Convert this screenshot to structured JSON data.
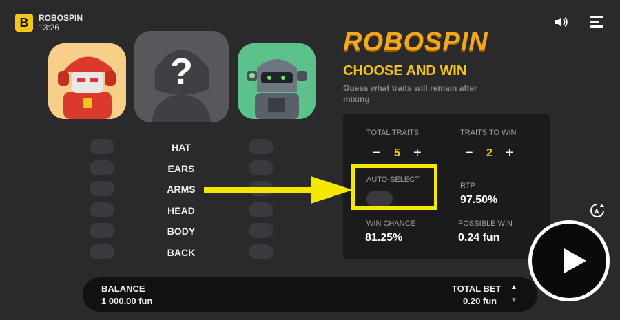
{
  "header": {
    "logo_letter": "B",
    "app_name": "ROBOSPIN",
    "clock": "13:26"
  },
  "game": {
    "brand": "ROBOSPIN",
    "title": "CHOOSE AND WIN",
    "subtitle": "Guess what traits will remain after mixing",
    "mystery_symbol": "?"
  },
  "traits": [
    "HAT",
    "EARS",
    "ARMS",
    "HEAD",
    "BODY",
    "BACK"
  ],
  "panel": {
    "total_traits_label": "TOTAL TRAITS",
    "total_traits_value": "5",
    "traits_to_win_label": "TRAITS TO WIN",
    "traits_to_win_value": "2",
    "minus": "−",
    "plus": "+",
    "auto_select_label": "AUTO-SELECT",
    "rtp_label": "RTP",
    "rtp_value": "97.50%",
    "win_chance_label": "WIN CHANCE",
    "win_chance_value": "81.25%",
    "possible_win_label": "POSSIBLE WIN",
    "possible_win_value": "0.24 fun"
  },
  "footer": {
    "balance_label": "BALANCE",
    "balance_value": "1 000.00 fun",
    "total_bet_label": "TOTAL BET",
    "total_bet_value": "0.20 fun",
    "up_arrow": "▲",
    "down_arrow": "▼"
  },
  "colors": {
    "accent": "#f5c518",
    "highlight": "#f5e800",
    "background": "#2a2a2c",
    "panel": "#1b1b1d"
  },
  "icons": [
    "sound-icon",
    "menu-icon",
    "autoplay-icon",
    "play-icon",
    "arrow-annotation"
  ]
}
